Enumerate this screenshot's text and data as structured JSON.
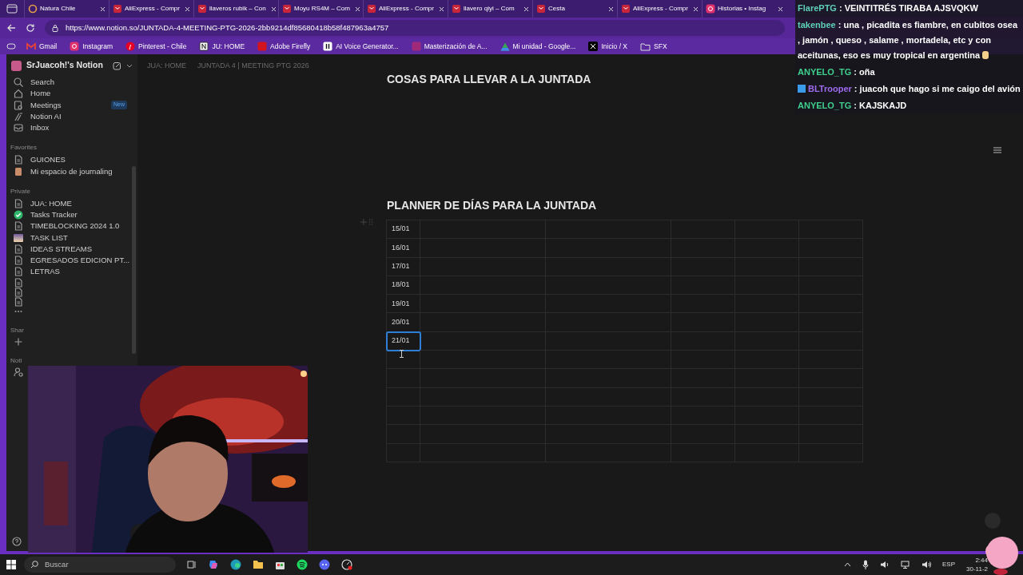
{
  "browser": {
    "tabs": [
      {
        "title": "Natura Chile",
        "kind": "natura"
      },
      {
        "title": "AliExpress - Compr",
        "kind": "ali"
      },
      {
        "title": "llaveros rubik – Con",
        "kind": "ali"
      },
      {
        "title": "Moyu RS4M – Com",
        "kind": "ali"
      },
      {
        "title": "AliExpress - Compr",
        "kind": "ali"
      },
      {
        "title": "llavero qiyi – Com",
        "kind": "ali"
      },
      {
        "title": "Cesta",
        "kind": "ali"
      },
      {
        "title": "AliExpress - Compr",
        "kind": "ali"
      },
      {
        "title": "Historias • Instag",
        "kind": "insta"
      }
    ],
    "url": "https://www.notion.so/JUNTADA-4-MEETING-PTG-2026-2bb9214df85680418b58f487963a4757",
    "bookmarks": [
      {
        "label": "Gmail",
        "kind": "gmail"
      },
      {
        "label": "Instagram",
        "kind": "insta"
      },
      {
        "label": "Pinterest - Chile",
        "kind": "pinterest"
      },
      {
        "label": "JU: HOME",
        "kind": "notion"
      },
      {
        "label": "Adobe Firefly",
        "kind": "firefly"
      },
      {
        "label": "AI Voice Generator...",
        "kind": "voice"
      },
      {
        "label": "Masterización de A...",
        "kind": "square"
      },
      {
        "label": "Mi unidad - Google...",
        "kind": "drive"
      },
      {
        "label": "Inicio / X",
        "kind": "x"
      },
      {
        "label": "SFX",
        "kind": "folder"
      }
    ]
  },
  "chat": {
    "messages": [
      {
        "user": "FlarePTG",
        "color": "#5fd0b8",
        "text": ": VEINTITRÉS TIRABA AJSVQKW",
        "badge": false,
        "emoji": false
      },
      {
        "user": "takenbee",
        "color": "#5fd0b8",
        "text": ": una , picadita es fiambre, en cubitos osea , jamón , queso , salame , mortadela, etc y con aceitunas, eso es muy tropical en argentina",
        "badge": false,
        "emoji": true
      },
      {
        "user": "ANYELO_TG",
        "color": "#3fcf8e",
        "text": ": oña",
        "badge": false,
        "emoji": false
      },
      {
        "user": "BLTrooper",
        "color": "#9f6bf0",
        "text": ": juacoh que hago si me caigo del avión",
        "badge": true,
        "emoji": false
      },
      {
        "user": "ANYELO_TG",
        "color": "#3fcf8e",
        "text": ": KAJSKAJD",
        "badge": false,
        "emoji": false
      }
    ]
  },
  "notion": {
    "workspace": "SrJuacoh!'s Notion",
    "breadcrumb": [
      "JUA: HOME",
      "JUNTADA 4 | MEETING PTG 2026"
    ],
    "nav": [
      {
        "label": "Search",
        "kind": "search"
      },
      {
        "label": "Home",
        "kind": "home"
      },
      {
        "label": "Meetings",
        "kind": "meetings",
        "badge": "New"
      },
      {
        "label": "Notion AI",
        "kind": "ai"
      },
      {
        "label": "Inbox",
        "kind": "inbox"
      }
    ],
    "sections": [
      {
        "title": "Favorites",
        "items": [
          {
            "label": "GUIONES",
            "kind": "page"
          },
          {
            "label": "Mi espacio de journaling",
            "kind": "journal"
          }
        ]
      },
      {
        "title": "Private",
        "items": [
          {
            "label": "JUA: HOME",
            "kind": "page"
          },
          {
            "label": "Tasks Tracker",
            "kind": "check"
          },
          {
            "label": "TIMEBLOCKING 2024 1.0",
            "kind": "page"
          },
          {
            "label": "TASK LIST",
            "kind": "gradient"
          },
          {
            "label": "IDEAS STREAMS",
            "kind": "page"
          },
          {
            "label": "EGRESADOS EDICION PT...",
            "kind": "page"
          },
          {
            "label": "LETRAS",
            "kind": "page"
          },
          {
            "kind": "page"
          },
          {
            "kind": "page"
          },
          {
            "kind": "page"
          },
          {
            "kind": "more"
          }
        ]
      },
      {
        "title": "Shar",
        "items": [
          {
            "kind": "plus"
          }
        ]
      },
      {
        "title": "Noti",
        "items": [
          {
            "kind": "person"
          }
        ]
      }
    ],
    "heading_top": "COSAS PARA LLEVAR A LA JUNTADA",
    "planner": {
      "title": "PLANNER DE DÍAS PARA LA JUNTADA",
      "rows": [
        {
          "cell": "15/01",
          "selected": false
        },
        {
          "cell": "16/01",
          "selected": false
        },
        {
          "cell": "17/01",
          "selected": false
        },
        {
          "cell": "18/01",
          "selected": false
        },
        {
          "cell": "19/01",
          "selected": false
        },
        {
          "cell": "20/01",
          "selected": false
        },
        {
          "cell": "21/01",
          "selected": true
        }
      ]
    }
  },
  "taskbar": {
    "search": "Buscar",
    "language": "ESP",
    "time": "2:44",
    "date": "30-11-2"
  }
}
